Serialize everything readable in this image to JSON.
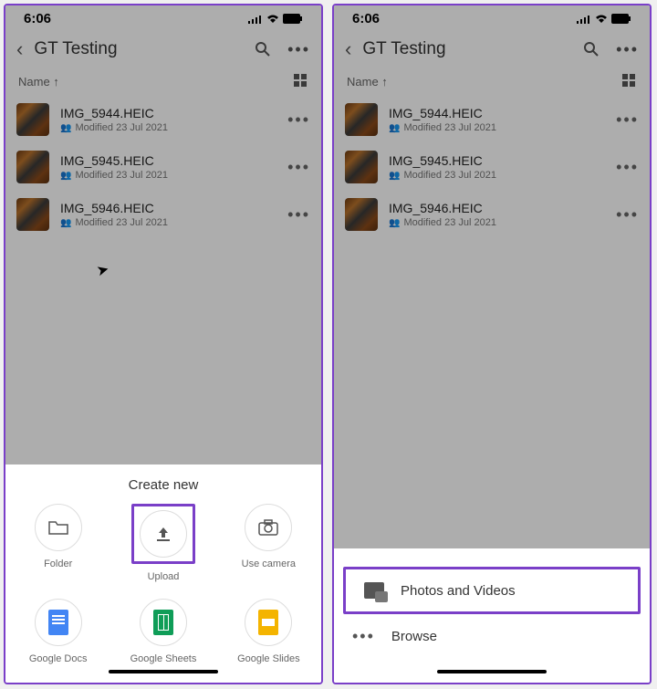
{
  "status": {
    "time": "6:06"
  },
  "header": {
    "folder": "GT Testing"
  },
  "sort": {
    "label": "Name ↑"
  },
  "files": [
    {
      "name": "IMG_5944.HEIC",
      "meta": "Modified 23 Jul 2021"
    },
    {
      "name": "IMG_5945.HEIC",
      "meta": "Modified 23 Jul 2021"
    },
    {
      "name": "IMG_5946.HEIC",
      "meta": "Modified 23 Jul 2021"
    }
  ],
  "create_sheet": {
    "title": "Create new",
    "options": {
      "folder": "Folder",
      "upload": "Upload",
      "camera": "Use camera",
      "docs": "Google Docs",
      "sheets": "Google Sheets",
      "slides": "Google Slides"
    }
  },
  "upload_sheet": {
    "photos_videos": "Photos and Videos",
    "browse": "Browse"
  }
}
